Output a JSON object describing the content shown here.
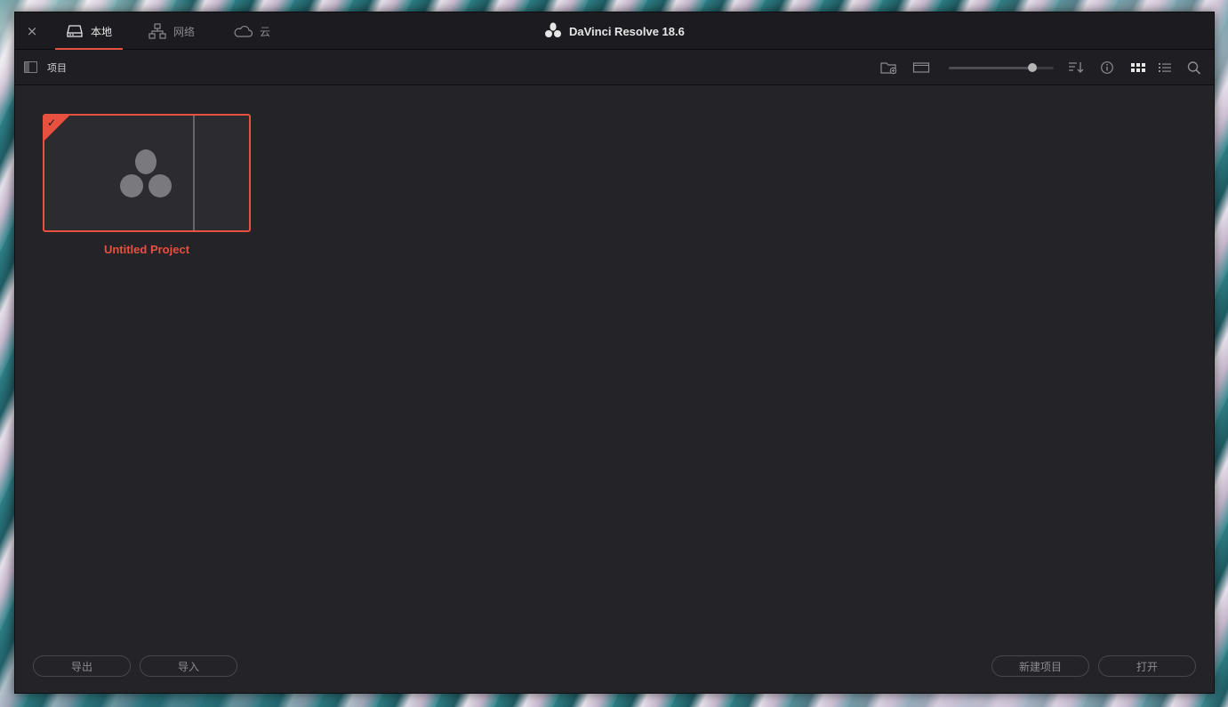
{
  "titlebar": {
    "close_label": "×",
    "tabs": [
      {
        "label": "本地",
        "icon": "drive-icon",
        "active": true
      },
      {
        "label": "网络",
        "icon": "network-icon",
        "active": false
      },
      {
        "label": "云",
        "icon": "cloud-icon",
        "active": false
      }
    ],
    "app_title": "DaVinci Resolve 18.6"
  },
  "toolbar": {
    "section_label": "项目",
    "zoom_level": 0.8,
    "icons": [
      "new-folder-icon",
      "folder-view-icon",
      "sort-icon",
      "info-icon",
      "grid-view-icon",
      "list-view-icon",
      "search-icon"
    ]
  },
  "projects": [
    {
      "name": "Untitled Project",
      "selected": true
    }
  ],
  "footer": {
    "export_label": "导出",
    "import_label": "导入",
    "new_project_label": "新建项目",
    "open_label": "打开"
  },
  "colors": {
    "accent": "#e8503f",
    "window_bg": "#232328",
    "titlebar_bg": "#1c1c20"
  }
}
